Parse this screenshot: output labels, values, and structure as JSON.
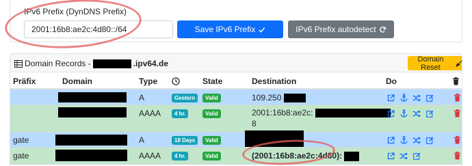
{
  "prefix": {
    "label": "IPv6 Prefix (DynDNS Prefix)",
    "value": "2001:16b8:ae2c:4d80::/64",
    "save_label": "Save IPv6 Prefix",
    "autodetect_label": "IPv6 Prefix autodetect"
  },
  "records": {
    "title_prefix": "Domain Records -",
    "title_suffix": ".ipv64.de",
    "reset_label": "Domain Reset",
    "columns": {
      "prefix": "Präfix",
      "domain": "Domain",
      "type": "Type",
      "state": "State",
      "destination": "Destination",
      "do": "Do"
    },
    "rows": [
      {
        "prefix": "",
        "type": "A",
        "age": "Gestern",
        "state": "Valid",
        "destination": "109.250",
        "destination_line2": ""
      },
      {
        "prefix": "",
        "type": "AAAA",
        "age": "4 hr.",
        "state": "Valid",
        "destination": "2001:16b8:ae2c:",
        "destination_line2": "8"
      },
      {
        "prefix": "gate",
        "type": "A",
        "age": "18 Days",
        "state": "Valid",
        "destination": "",
        "destination_line2": ""
      },
      {
        "prefix": "gate",
        "type": "AAAA",
        "age": "4 hr.",
        "state": "Valid",
        "destination": "(2001:16b8:ae2c:4d80):",
        "destination_line2": ""
      }
    ]
  },
  "colors": {
    "primary": "#0d6efd",
    "secondary": "#6c757d",
    "warning": "#ffc107",
    "row_blue": "#b8daff",
    "row_green": "#c3e6cb",
    "badge_info": "#17a2b8",
    "badge_success": "#28a745",
    "danger": "#dc3545",
    "annotation": "#e25c5c"
  },
  "icons": [
    "check-icon",
    "refresh-icon",
    "table-icon",
    "broom-icon",
    "clock-icon",
    "trash-icon",
    "external-link-icon",
    "anchor-icon",
    "shuffle-icon",
    "edit-icon"
  ]
}
